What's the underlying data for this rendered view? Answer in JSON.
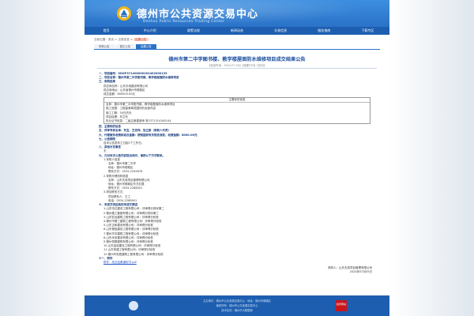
{
  "header": {
    "site_title": "德州市公共资源交易中心",
    "site_subtitle": "Dezhou Public Resources Trading Center"
  },
  "nav": [
    "首页",
    "中心介绍",
    "政策法规",
    "新闻动态",
    "交易信息",
    "服务指南",
    "下载专区"
  ],
  "breadcrumb": {
    "prefix": "当前位置：首页 > 交易信息 >",
    "current": "结果公告"
  },
  "tabs": [
    "采购公告",
    "更正公告",
    "结果公告"
  ],
  "article": {
    "title": "德州市第二中学图书楼、教学楼屋面防水维修项目成交结果公告",
    "meta": "【信息时间：2024-07-05】【我要打印】【关闭】",
    "lines": [
      {
        "t": "一、项目编号：SDGP371400000202402000139",
        "c": "h"
      },
      {
        "t": "二、项目名称：德州市第二中学图书楼、教学楼屋面防水维修项目",
        "c": "h"
      },
      {
        "t": "三、采购结果",
        "c": "h"
      },
      {
        "t": "供应商名称：山东天地建设有限公司",
        "c": "i1"
      },
      {
        "t": "供应商地址：山东省德州市德城区",
        "c": "i1"
      },
      {
        "t": "成交金额：800000.00元",
        "c": "i1"
      }
    ],
    "box_title": "主要标的信息",
    "box_lines": [
      "名称：德州市第二中学图书楼、教学楼屋面防水维修项目",
      "施工范围：工程量清单范围内的全部内容",
      "施工工期：30日历天",
      "项目经理：刘卫东",
      "执业证书信息：二级注册建造师 鲁2371314160144"
    ],
    "lines2": [
      {
        "t": "四、主要标的信息",
        "c": "h"
      },
      {
        "t": "五、评审专家名单：刘玉、王志伟、张立新（采购人代表）",
        "c": "h"
      },
      {
        "t": "六、代理服务收费标准及金额：按照国家有关规定收取，收费金额：8000.00元",
        "c": "h"
      },
      {
        "t": "七、公告期限",
        "c": "h"
      },
      {
        "t": "自本公告发布之日起1个工作日。",
        "c": "i1"
      },
      {
        "t": "八、其他补充事宜",
        "c": "h"
      },
      {
        "t": "无",
        "c": "i1"
      },
      {
        "t": "九、凡对本次公告内容提出询问，请按以下方式联系。",
        "c": "h"
      },
      {
        "t": "1.采购人信息",
        "c": "i1"
      },
      {
        "t": "名称：德州市第二中学",
        "c": "i2"
      },
      {
        "t": "地址：德州市德城区",
        "c": "i2"
      },
      {
        "t": "联系方式：0534-2345678",
        "c": "i2"
      },
      {
        "t": "2.采购代理机构信息",
        "c": "i1"
      },
      {
        "t": "名称：山东天成项目管理有限公司",
        "c": "i2"
      },
      {
        "t": "地址：德州市德城区东方红路",
        "c": "i2"
      },
      {
        "t": "联系方式：0534-2288001",
        "c": "i2"
      },
      {
        "t": "3.项目联系方式",
        "c": "i1"
      },
      {
        "t": "项目联系人：王工",
        "c": "i2"
      },
      {
        "t": "电话：0534-2288001",
        "c": "i2"
      },
      {
        "t": "十、未成交供应商的未成交原因",
        "c": "h"
      },
      {
        "t": "1.山东鸿达建设工程有限公司：评审得分排序第二",
        "c": "i1"
      },
      {
        "t": "2.德州建工集团有限公司：评审得分排序第三",
        "c": "i1"
      },
      {
        "t": "3.山东宏远建筑工程有限公司：评审得分较低",
        "c": "i1"
      },
      {
        "t": "4.德州市第三建筑工程有限公司：评审得分较低",
        "c": "i1"
      },
      {
        "t": "5.山东正和建设有限公司：评审得分较低",
        "c": "i1"
      },
      {
        "t": "6.山东德信建设工程有限公司：评审得分较低",
        "c": "i1"
      },
      {
        "t": "7.德州华宇建筑工程有限公司：评审得分较低",
        "c": "i1"
      },
      {
        "t": "8.山东永安建设有限公司：评审得分较低",
        "c": "i1"
      },
      {
        "t": "9.德州恒基建筑有限公司：评审得分较低",
        "c": "i1"
      },
      {
        "t": "10.山东金诺建设工程有限公司：评审得分较低",
        "c": "i1"
      },
      {
        "t": "11.山东鲁建工程有限公司：评审得分较低",
        "c": "i1"
      },
      {
        "t": "12.德州市安居建筑工程有限公司：评审得分较低",
        "c": "i1"
      },
      {
        "t": "十一、附件",
        "c": "h"
      },
      {
        "t": "附件：成交结果通知书.pdf",
        "c": "link"
      }
    ],
    "sign_org": "采购人：山东天成项目管理有限公司",
    "sign_date": "2024年07月05日"
  },
  "footer": {
    "line1": "主办单位：德州市公共资源交易中心　地址：德州市德城区",
    "line2": "版权所有：德州市公共资源交易中心",
    "line3": "技术支持：德州市大数据局",
    "badge_right": "政府网站"
  },
  "colors": {
    "header_blue": "#2a72c8",
    "nav_blue": "#1d5eb0",
    "title_blue": "#1a4ea0",
    "accent_red": "#c8161d"
  }
}
